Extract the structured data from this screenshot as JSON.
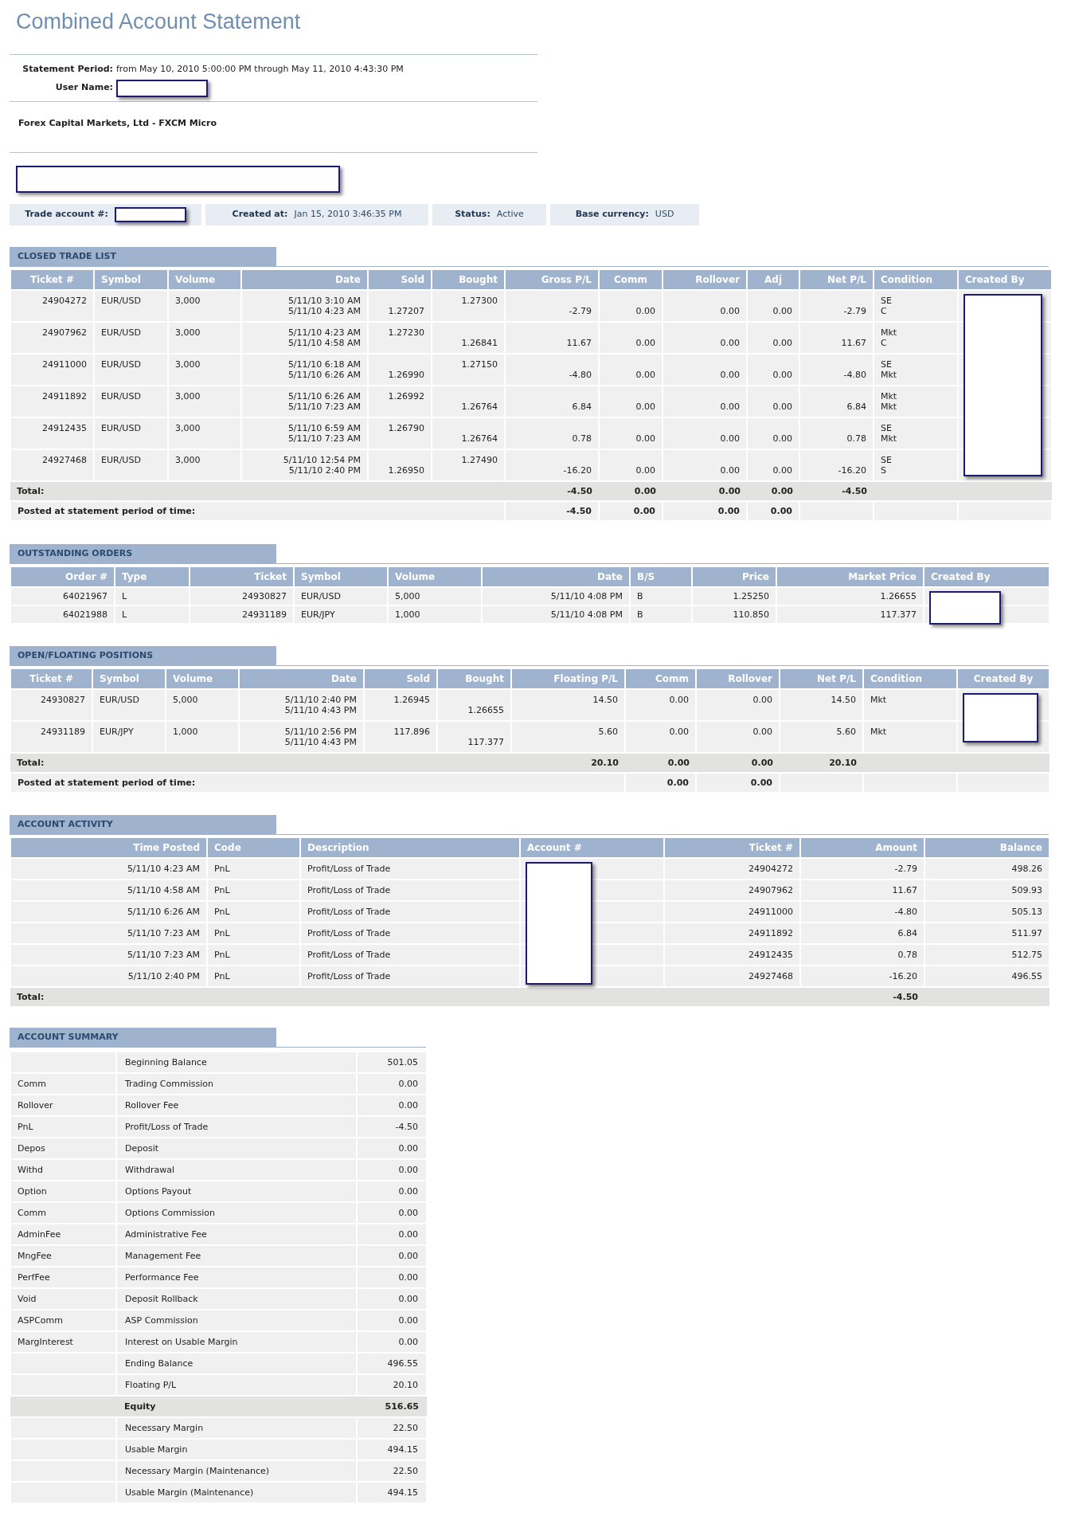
{
  "title": "Combined Account Statement",
  "statement_period": {
    "label": "Statement Period:",
    "value": "from May 10, 2010 5:00:00 PM through May 11, 2010 4:43:30 PM"
  },
  "user_name": {
    "label": "User Name:",
    "redacted": true
  },
  "broker": "Forex Capital Markets, Ltd - FXCM Micro",
  "account_name": {
    "redacted": true
  },
  "account_info": [
    {
      "label": "Trade account #:",
      "redacted": true
    },
    {
      "label": "Created at:",
      "value": "Jan 15, 2010 3:46:35 PM",
      "redacted": false
    },
    {
      "label": "Status:",
      "value": "Active",
      "redacted": false
    },
    {
      "label": "Base currency:",
      "value": "USD",
      "redacted": false
    }
  ],
  "closed_trades": {
    "title": "CLOSED TRADE LIST",
    "columns": [
      {
        "label": "Ticket #",
        "redacted": false
      },
      {
        "label": "Symbol",
        "redacted": false
      },
      {
        "label": "Volume",
        "redacted": false
      },
      {
        "label": "Date",
        "redacted": false
      },
      {
        "label": "Sold",
        "redacted": false
      },
      {
        "label": "Bought",
        "redacted": false
      },
      {
        "label": "Gross P/L",
        "redacted": false
      },
      {
        "label": "Comm",
        "redacted": false
      },
      {
        "label": "Rollover",
        "redacted": false
      },
      {
        "label": "Adj",
        "redacted": false
      },
      {
        "label": "Net P/L",
        "redacted": false
      },
      {
        "label": "Condition",
        "redacted": false
      },
      {
        "label": "Created By",
        "redacted": true
      }
    ],
    "rows": [
      {
        "sold_first": false,
        "cells": [
          "24904272",
          "EUR/USD",
          "3,000",
          [
            "5/11/10 3:10 AM",
            "5/11/10 4:23 AM"
          ],
          "1.27207",
          "1.27300",
          "-2.79",
          "0.00",
          "0.00",
          "0.00",
          "-2.79",
          [
            "SE",
            "C"
          ]
        ]
      },
      {
        "sold_first": true,
        "cells": [
          "24907962",
          "EUR/USD",
          "3,000",
          [
            "5/11/10 4:23 AM",
            "5/11/10 4:58 AM"
          ],
          "1.27230",
          "1.26841",
          "11.67",
          "0.00",
          "0.00",
          "0.00",
          "11.67",
          [
            "Mkt",
            "C"
          ]
        ]
      },
      {
        "sold_first": false,
        "cells": [
          "24911000",
          "EUR/USD",
          "3,000",
          [
            "5/11/10 6:18 AM",
            "5/11/10 6:26 AM"
          ],
          "1.26990",
          "1.27150",
          "-4.80",
          "0.00",
          "0.00",
          "0.00",
          "-4.80",
          [
            "SE",
            "Mkt"
          ]
        ]
      },
      {
        "sold_first": true,
        "cells": [
          "24911892",
          "EUR/USD",
          "3,000",
          [
            "5/11/10 6:26 AM",
            "5/11/10 7:23 AM"
          ],
          "1.26992",
          "1.26764",
          "6.84",
          "0.00",
          "0.00",
          "0.00",
          "6.84",
          [
            "Mkt",
            "Mkt"
          ]
        ]
      },
      {
        "sold_first": true,
        "cells": [
          "24912435",
          "EUR/USD",
          "3,000",
          [
            "5/11/10 6:59 AM",
            "5/11/10 7:23 AM"
          ],
          "1.26790",
          "1.26764",
          "0.78",
          "0.00",
          "0.00",
          "0.00",
          "0.78",
          [
            "SE",
            "Mkt"
          ]
        ]
      },
      {
        "sold_first": false,
        "cells": [
          "24927468",
          "EUR/USD",
          "3,000",
          [
            "5/11/10 12:54 PM",
            "5/11/10 2:40 PM"
          ],
          "1.26950",
          "1.27490",
          "-16.20",
          "0.00",
          "0.00",
          "0.00",
          "-16.20",
          [
            "SE",
            "S"
          ]
        ]
      }
    ],
    "totals": [
      {
        "kind": "total",
        "cells": [
          "Total:",
          null,
          null,
          null,
          null,
          null,
          "-4.50",
          "0.00",
          "0.00",
          "0.00",
          "-4.50",
          null,
          null
        ]
      },
      {
        "kind": "posted",
        "cells": [
          "Posted at statement period of time:",
          null,
          null,
          null,
          null,
          null,
          "-4.50",
          "0.00",
          "0.00",
          "0.00",
          null,
          null,
          null
        ]
      }
    ]
  },
  "outstanding_orders": {
    "title": "OUTSTANDING ORDERS",
    "columns": [
      {
        "label": "Order #",
        "redacted": false
      },
      {
        "label": "Type",
        "redacted": false
      },
      {
        "label": "Ticket",
        "redacted": false
      },
      {
        "label": "Symbol",
        "redacted": false
      },
      {
        "label": "Volume",
        "redacted": false
      },
      {
        "label": "Date",
        "redacted": false
      },
      {
        "label": "B/S",
        "redacted": false
      },
      {
        "label": "Price",
        "redacted": false
      },
      {
        "label": "Market Price",
        "redacted": false
      },
      {
        "label": "Created By",
        "redacted": true
      }
    ],
    "rows": [
      {
        "cells": [
          "64021967",
          "L",
          "24930827",
          "EUR/USD",
          "5,000",
          "5/11/10 4:08 PM",
          "B",
          "1.25250",
          "1.26655"
        ]
      },
      {
        "cells": [
          "64021988",
          "L",
          "24931189",
          "EUR/JPY",
          "1,000",
          "5/11/10 4:08 PM",
          "B",
          "110.850",
          "117.377"
        ]
      }
    ]
  },
  "open_positions": {
    "title": "OPEN/FLOATING POSITIONS",
    "columns": [
      {
        "label": "Ticket #",
        "redacted": false
      },
      {
        "label": "Symbol",
        "redacted": false
      },
      {
        "label": "Volume",
        "redacted": false
      },
      {
        "label": "Date",
        "redacted": false
      },
      {
        "label": "Sold",
        "redacted": false
      },
      {
        "label": "Bought",
        "redacted": false
      },
      {
        "label": "Floating P/L",
        "redacted": false
      },
      {
        "label": "Comm",
        "redacted": false
      },
      {
        "label": "Rollover",
        "redacted": false
      },
      {
        "label": "Net P/L",
        "redacted": false
      },
      {
        "label": "Condition",
        "redacted": false
      },
      {
        "label": "Created By",
        "redacted": true
      }
    ],
    "rows": [
      {
        "sold_first": true,
        "cells": [
          "24930827",
          "EUR/USD",
          "5,000",
          [
            "5/11/10 2:40 PM",
            "5/11/10 4:43 PM"
          ],
          "1.26945",
          "1.26655",
          "14.50",
          "0.00",
          "0.00",
          "14.50",
          "Mkt"
        ]
      },
      {
        "sold_first": true,
        "cells": [
          "24931189",
          "EUR/JPY",
          "1,000",
          [
            "5/11/10 2:56 PM",
            "5/11/10 4:43 PM"
          ],
          "117.896",
          "117.377",
          "5.60",
          "0.00",
          "0.00",
          "5.60",
          "Mkt"
        ]
      }
    ],
    "totals": [
      {
        "kind": "total",
        "cells": [
          "Total:",
          null,
          null,
          null,
          null,
          null,
          "20.10",
          "0.00",
          "0.00",
          "20.10",
          null,
          null
        ]
      },
      {
        "kind": "posted",
        "cells": [
          "Posted at statement period of time:",
          null,
          null,
          null,
          null,
          null,
          null,
          "0.00",
          "0.00",
          null,
          null,
          null
        ]
      }
    ]
  },
  "account_activity": {
    "title": "ACCOUNT ACTIVITY",
    "columns": [
      {
        "label": "Time Posted",
        "redacted": false
      },
      {
        "label": "Code",
        "redacted": false
      },
      {
        "label": "Description",
        "redacted": false
      },
      {
        "label": "Account #",
        "redacted": true
      },
      {
        "label": "Ticket #",
        "redacted": false
      },
      {
        "label": "Amount",
        "redacted": false
      },
      {
        "label": "Balance",
        "redacted": false
      }
    ],
    "rows": [
      {
        "cells": [
          "5/11/10 4:23 AM",
          "PnL",
          "Profit/Loss of Trade",
          null,
          "24904272",
          "-2.79",
          "498.26"
        ]
      },
      {
        "cells": [
          "5/11/10 4:58 AM",
          "PnL",
          "Profit/Loss of Trade",
          null,
          "24907962",
          "11.67",
          "509.93"
        ]
      },
      {
        "cells": [
          "5/11/10 6:26 AM",
          "PnL",
          "Profit/Loss of Trade",
          null,
          "24911000",
          "-4.80",
          "505.13"
        ]
      },
      {
        "cells": [
          "5/11/10 7:23 AM",
          "PnL",
          "Profit/Loss of Trade",
          null,
          "24911892",
          "6.84",
          "511.97"
        ]
      },
      {
        "cells": [
          "5/11/10 7:23 AM",
          "PnL",
          "Profit/Loss of Trade",
          null,
          "24912435",
          "0.78",
          "512.75"
        ]
      },
      {
        "cells": [
          "5/11/10 2:40 PM",
          "PnL",
          "Profit/Loss of Trade",
          null,
          "24927468",
          "-16.20",
          "496.55"
        ]
      }
    ],
    "totals": [
      {
        "kind": "total",
        "cells": [
          "Total:",
          null,
          null,
          null,
          null,
          "-4.50",
          null
        ]
      }
    ]
  },
  "account_summary": {
    "title": "ACCOUNT SUMMARY",
    "rows": [
      {
        "description": "Beginning Balance",
        "value": "501.05",
        "highlighted": false
      },
      {
        "code": "Comm",
        "description": "Trading Commission",
        "value": "0.00",
        "highlighted": false
      },
      {
        "code": "Rollover",
        "description": "Rollover Fee",
        "value": "0.00",
        "highlighted": false
      },
      {
        "code": "PnL",
        "description": "Profit/Loss of Trade",
        "value": "-4.50",
        "highlighted": false
      },
      {
        "code": "Depos",
        "description": "Deposit",
        "value": "0.00",
        "highlighted": false
      },
      {
        "code": "Withd",
        "description": "Withdrawal",
        "value": "0.00",
        "highlighted": false
      },
      {
        "code": "Option",
        "description": "Options Payout",
        "value": "0.00",
        "highlighted": false
      },
      {
        "code": "Comm",
        "description": "Options Commission",
        "value": "0.00",
        "highlighted": false
      },
      {
        "code": "AdminFee",
        "description": "Administrative Fee",
        "value": "0.00",
        "highlighted": false
      },
      {
        "code": "MngFee",
        "description": "Management Fee",
        "value": "0.00",
        "highlighted": false
      },
      {
        "code": "PerfFee",
        "description": "Performance Fee",
        "value": "0.00",
        "highlighted": false
      },
      {
        "code": "Void",
        "description": "Deposit Rollback",
        "value": "0.00",
        "highlighted": false
      },
      {
        "code": "ASPComm",
        "description": "ASP Commission",
        "value": "0.00",
        "highlighted": false
      },
      {
        "code": "MargInterest",
        "description": "Interest on Usable Margin",
        "value": "0.00",
        "highlighted": false
      },
      {
        "description": "Ending Balance",
        "value": "496.55",
        "highlighted": false
      },
      {
        "description": "Floating P/L",
        "value": "20.10",
        "highlighted": false
      },
      {
        "description": "Equity",
        "value": "516.65",
        "highlighted": true
      },
      {
        "description": "Necessary Margin",
        "value": "22.50",
        "highlighted": false
      },
      {
        "description": "Usable Margin",
        "value": "494.15",
        "highlighted": false
      },
      {
        "description": "Necessary Margin (Maintenance)",
        "value": "22.50",
        "highlighted": false
      },
      {
        "description": "Usable Margin (Maintenance)",
        "value": "494.15",
        "highlighted": false
      }
    ]
  }
}
